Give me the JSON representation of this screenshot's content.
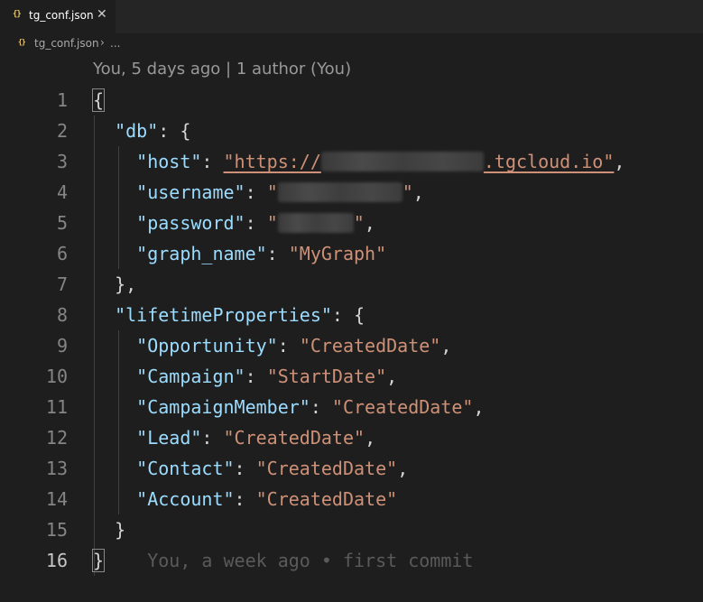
{
  "tab": {
    "icon": "{}",
    "filename": "tg_conf.json",
    "close": "✕"
  },
  "breadcrumb": {
    "icon": "{}",
    "file": "tg_conf.json",
    "separator": "›",
    "more": "..."
  },
  "codelens": "You, 5 days ago | 1 author (You)",
  "json": {
    "db_key": "\"db\"",
    "host_key": "\"host\"",
    "host_prefix": "\"https://",
    "host_suffix": ".tgcloud.io\"",
    "username_key": "\"username\"",
    "password_key": "\"password\"",
    "graph_name_key": "\"graph_name\"",
    "graph_name_value": "\"MyGraph\"",
    "lifetime_key": "\"lifetimeProperties\"",
    "props": [
      {
        "key": "\"Opportunity\"",
        "value": "\"CreatedDate\""
      },
      {
        "key": "\"Campaign\"",
        "value": "\"StartDate\""
      },
      {
        "key": "\"CampaignMember\"",
        "value": "\"CreatedDate\""
      },
      {
        "key": "\"Lead\"",
        "value": "\"CreatedDate\""
      },
      {
        "key": "\"Contact\"",
        "value": "\"CreatedDate\""
      },
      {
        "key": "\"Account\"",
        "value": "\"CreatedDate\""
      }
    ]
  },
  "line_numbers": [
    "1",
    "2",
    "3",
    "4",
    "5",
    "6",
    "7",
    "8",
    "9",
    "10",
    "11",
    "12",
    "13",
    "14",
    "15",
    "16"
  ],
  "blame_inline": "You, a week ago • first commit"
}
